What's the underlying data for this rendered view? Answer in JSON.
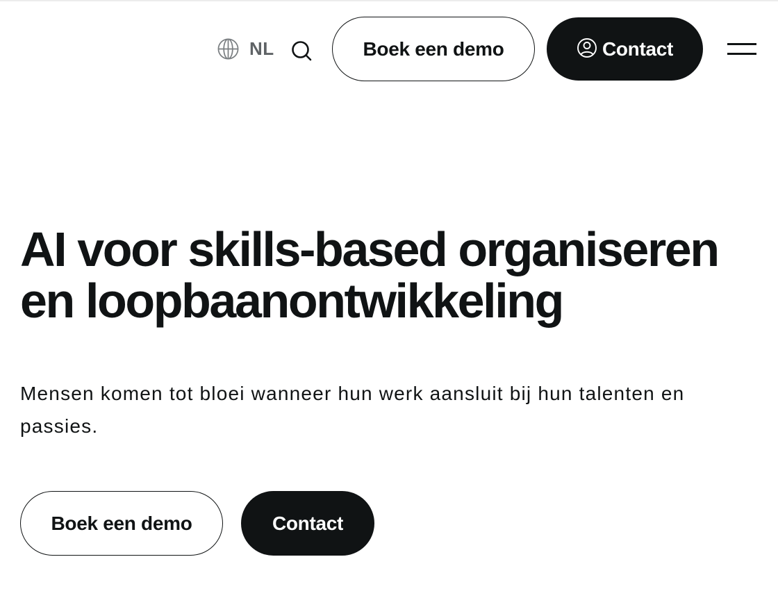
{
  "header": {
    "language_code": "NL",
    "demo_label": "Boek een demo",
    "contact_label": "Contact"
  },
  "hero": {
    "title": "AI voor skills-based organiseren en loopbaanontwikkeling",
    "subtitle": "Mensen komen tot bloei wanneer hun werk aansluit bij hun talenten en passies.",
    "demo_label": "Boek een demo",
    "contact_label": "Contact"
  },
  "icons": {
    "language": "globe-icon",
    "search": "search-icon",
    "contact": "user-circle-icon",
    "menu": "hamburger-menu-icon"
  },
  "colors": {
    "text": "#101314",
    "muted": "#5f6366",
    "background": "#ffffff",
    "dark_button": "#101314"
  }
}
